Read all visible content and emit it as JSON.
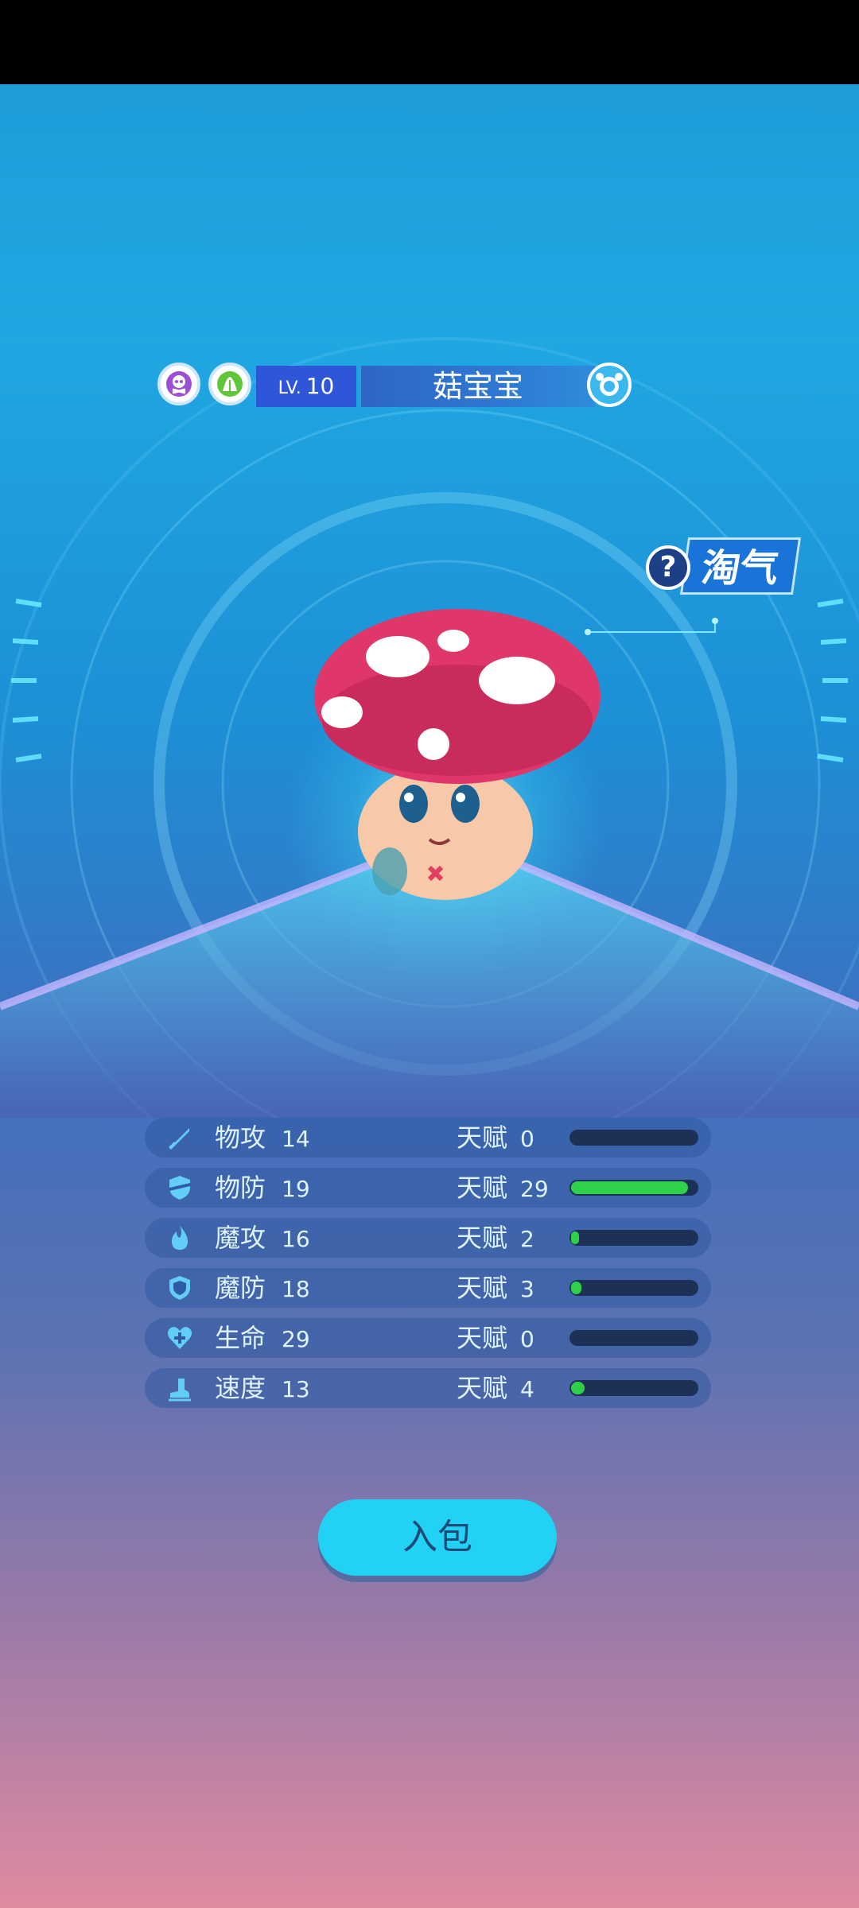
{
  "pet": {
    "level_prefix": "LV.",
    "level": "10",
    "name": "菇宝宝",
    "trait": "淘气",
    "trait_hint": "?"
  },
  "stats": [
    {
      "label": "物攻",
      "value": "14",
      "talent_label": "天赋",
      "talent": "0",
      "icon": "sword-icon",
      "fill": 0
    },
    {
      "label": "物防",
      "value": "19",
      "talent_label": "天赋",
      "talent": "29",
      "icon": "shield-icon",
      "fill": 0.93
    },
    {
      "label": "魔攻",
      "value": "16",
      "talent_label": "天赋",
      "talent": "2",
      "icon": "flame-icon",
      "fill": 0.06
    },
    {
      "label": "魔防",
      "value": "18",
      "talent_label": "天赋",
      "talent": "3",
      "icon": "magic-shield-icon",
      "fill": 0.08
    },
    {
      "label": "生命",
      "value": "29",
      "talent_label": "天赋",
      "talent": "0",
      "icon": "heart-icon",
      "fill": 0
    },
    {
      "label": "速度",
      "value": "13",
      "talent_label": "天赋",
      "talent": "4",
      "icon": "boot-icon",
      "fill": 0.11
    }
  ],
  "actions": {
    "bag_label": "入包"
  },
  "colors": {
    "talent_bar_fill": "#2fd14a",
    "button": "#22d2f5"
  }
}
